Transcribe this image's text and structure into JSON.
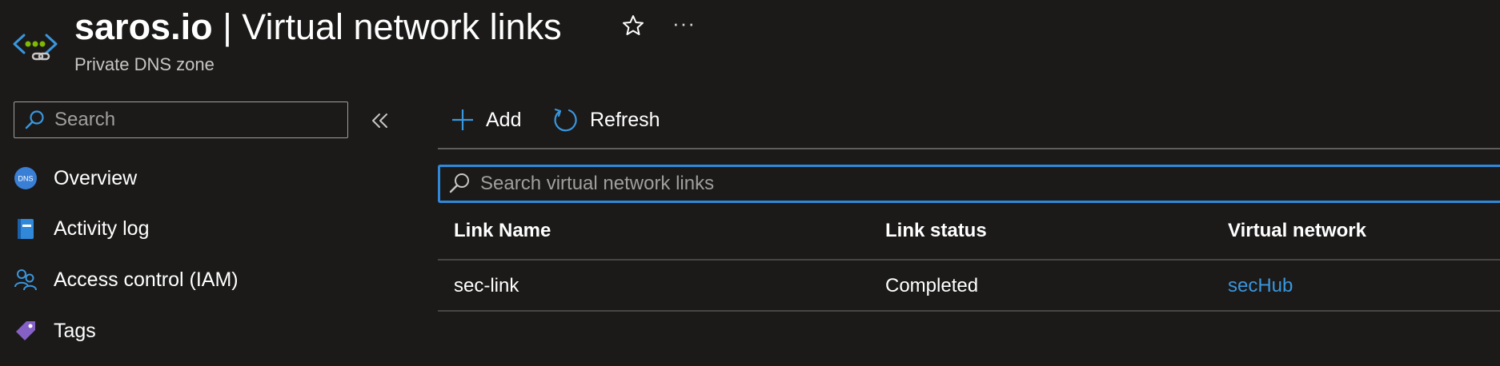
{
  "header": {
    "title_resource": "saros.io",
    "title_separator": " | ",
    "title_page": "Virtual network links",
    "subtitle": "Private DNS zone",
    "resource_icon": "private-dns-zone-icon",
    "favorite_icon": "star-icon",
    "more_icon": "ellipsis-icon",
    "more_label": "···"
  },
  "sidebar": {
    "search_placeholder": "Search",
    "collapse_icon": "double-chevron-left-icon",
    "items": [
      {
        "label": "Overview",
        "icon": "dns-icon",
        "icon_text": "DNS"
      },
      {
        "label": "Activity log",
        "icon": "activity-log-icon"
      },
      {
        "label": "Access control (IAM)",
        "icon": "users-icon"
      },
      {
        "label": "Tags",
        "icon": "tag-icon"
      }
    ]
  },
  "toolbar": {
    "add_label": "Add",
    "refresh_label": "Refresh"
  },
  "main": {
    "search_placeholder": "Search virtual network links",
    "columns": [
      "Link Name",
      "Link status",
      "Virtual network"
    ],
    "rows": [
      {
        "link_name": "sec-link",
        "link_status": "Completed",
        "virtual_network": "secHub"
      }
    ]
  },
  "colors": {
    "background": "#1b1a19",
    "accent": "#2f88d9",
    "link": "#3a96dd",
    "muted_text": "#c8c6c4"
  }
}
